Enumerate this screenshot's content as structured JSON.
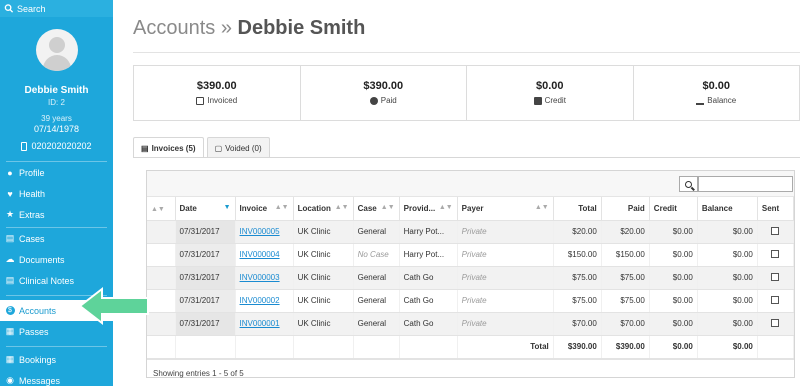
{
  "sidebar": {
    "search_label": "Search",
    "profile": {
      "name": "Debbie Smith",
      "id": "ID: 2",
      "age": "39 years",
      "dob": "07/14/1978",
      "phone": "020202020202"
    },
    "items": [
      {
        "label": "Profile",
        "icon": "user-icon"
      },
      {
        "label": "Health",
        "icon": "heart-icon"
      },
      {
        "label": "Extras",
        "icon": "star-icon"
      },
      {
        "label": "Cases",
        "icon": "folder-icon"
      },
      {
        "label": "Documents",
        "icon": "cloud-icon"
      },
      {
        "label": "Clinical Notes",
        "icon": "notes-icon"
      },
      {
        "label": "Accounts",
        "icon": "dollar-icon",
        "active": true
      },
      {
        "label": "Passes",
        "icon": "ticket-icon"
      },
      {
        "label": "Bookings",
        "icon": "calendar-icon"
      },
      {
        "label": "Messages",
        "icon": "message-icon"
      }
    ],
    "colors": {
      "background": "#1ea7db",
      "active_text": "#1a9bcf"
    }
  },
  "header": {
    "title_prefix": "Accounts »",
    "title_name": "Debbie Smith"
  },
  "summary": [
    {
      "value": "$390.00",
      "label": "Invoiced",
      "icon": "invoice-icon"
    },
    {
      "value": "$390.00",
      "label": "Paid",
      "icon": "coin-icon"
    },
    {
      "value": "$0.00",
      "label": "Credit",
      "icon": "wallet-icon"
    },
    {
      "value": "$0.00",
      "label": "Balance",
      "icon": "scale-icon"
    }
  ],
  "tabs": [
    {
      "label": "Invoices (5)",
      "icon": "invoice-icon",
      "active": true
    },
    {
      "label": "Voided (0)",
      "icon": "trash-icon",
      "active": false
    }
  ],
  "table": {
    "columns": [
      "Date",
      "Invoice",
      "Location",
      "Case",
      "Provid...",
      "Payer",
      "Total",
      "Paid",
      "Credit",
      "Balance",
      "Sent"
    ],
    "rows": [
      {
        "date": "07/31/2017",
        "invoice": "INV000005",
        "location": "UK Clinic",
        "case": "General",
        "provider": "Harry Pot...",
        "payer": "Private",
        "total": "$20.00",
        "paid": "$20.00",
        "credit": "$0.00",
        "balance": "$0.00",
        "sent": false
      },
      {
        "date": "07/31/2017",
        "invoice": "INV000004",
        "location": "UK Clinic",
        "case": "No Case",
        "provider": "Harry Pot...",
        "payer": "Private",
        "total": "$150.00",
        "paid": "$150.00",
        "credit": "$0.00",
        "balance": "$0.00",
        "sent": false
      },
      {
        "date": "07/31/2017",
        "invoice": "INV000003",
        "location": "UK Clinic",
        "case": "General",
        "provider": "Cath Go",
        "payer": "Private",
        "total": "$75.00",
        "paid": "$75.00",
        "credit": "$0.00",
        "balance": "$0.00",
        "sent": false
      },
      {
        "date": "07/31/2017",
        "invoice": "INV000002",
        "location": "UK Clinic",
        "case": "General",
        "provider": "Cath Go",
        "payer": "Private",
        "total": "$75.00",
        "paid": "$75.00",
        "credit": "$0.00",
        "balance": "$0.00",
        "sent": false
      },
      {
        "date": "07/31/2017",
        "invoice": "INV000001",
        "location": "UK Clinic",
        "case": "General",
        "provider": "Cath Go",
        "payer": "Private",
        "total": "$70.00",
        "paid": "$70.00",
        "credit": "$0.00",
        "balance": "$0.00",
        "sent": false
      }
    ],
    "totals": {
      "label": "Total",
      "total": "$390.00",
      "paid": "$390.00",
      "credit": "$0.00",
      "balance": "$0.00"
    },
    "info": "Showing entries 1 - 5 of 5"
  },
  "annotation": {
    "color": "#5ed39a",
    "icon": "pointer-arrow-icon"
  }
}
